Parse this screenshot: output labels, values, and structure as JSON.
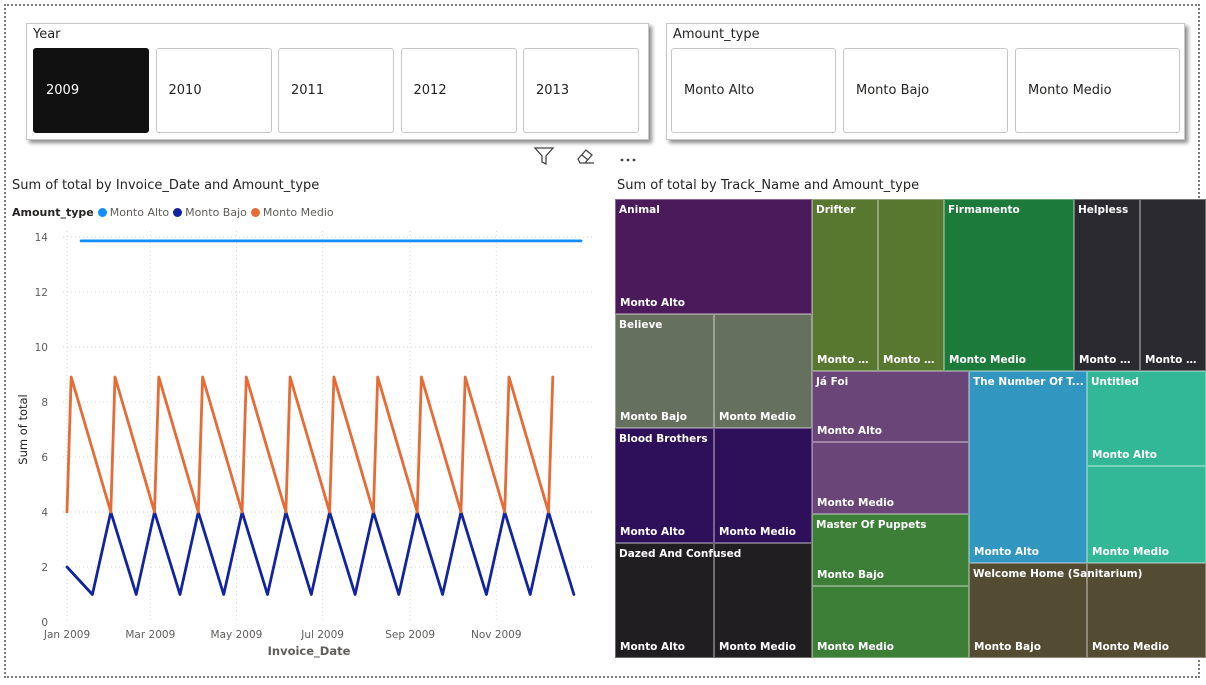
{
  "year_slicer": {
    "title": "Year",
    "options": [
      "2009",
      "2010",
      "2011",
      "2012",
      "2013"
    ],
    "selected": "2009"
  },
  "amount_slicer": {
    "title": "Amount_type",
    "options": [
      "Monto Alto",
      "Monto Bajo",
      "Monto Medio"
    ]
  },
  "header_icons": [
    "filter-icon",
    "eraser-icon",
    "more-options-icon"
  ],
  "line_chart": {
    "title": "Sum of total by Invoice_Date and Amount_type",
    "legend_title": "Amount_type",
    "chart_data": {
      "type": "line",
      "xlabel": "Invoice_Date",
      "ylabel": "Sum of total",
      "ylim": [
        0,
        14
      ],
      "yticks": [
        "0",
        "2",
        "4",
        "6",
        "8",
        "10",
        "12",
        "14"
      ],
      "xticks": [
        "Jan 2009",
        "Mar 2009",
        "May 2009",
        "Jul 2009",
        "Sep 2009",
        "Nov 2009"
      ],
      "grid": true,
      "legend_position": "top-left",
      "series": [
        {
          "name": "Monto Alto",
          "color": "#118dff",
          "points": [
            [
              "2009-01-11",
              13.86
            ],
            [
              "2009-12-31",
              13.86
            ]
          ]
        },
        {
          "name": "Monto Bajo",
          "color": "#12239e",
          "points": [
            [
              "2009-01-01",
              2
            ],
            [
              "2009-01-19",
              1
            ],
            [
              "2009-02-01",
              4
            ],
            [
              "2009-02-19",
              1
            ],
            [
              "2009-03-04",
              4
            ],
            [
              "2009-03-22",
              1
            ],
            [
              "2009-04-04",
              4
            ],
            [
              "2009-04-22",
              1
            ],
            [
              "2009-05-05",
              4
            ],
            [
              "2009-05-23",
              1
            ],
            [
              "2009-06-05",
              4
            ],
            [
              "2009-06-23",
              1
            ],
            [
              "2009-07-06",
              4
            ],
            [
              "2009-07-24",
              1
            ],
            [
              "2009-08-06",
              4
            ],
            [
              "2009-08-24",
              1
            ],
            [
              "2009-09-06",
              4
            ],
            [
              "2009-09-24",
              1
            ],
            [
              "2009-10-07",
              4
            ],
            [
              "2009-10-25",
              1
            ],
            [
              "2009-11-07",
              4
            ],
            [
              "2009-11-25",
              1
            ],
            [
              "2009-12-08",
              4
            ],
            [
              "2009-12-26",
              1
            ]
          ]
        },
        {
          "name": "Monto Medio",
          "color": "#e66c37",
          "points": [
            [
              "2009-01-01",
              4
            ],
            [
              "2009-01-04",
              8.91
            ],
            [
              "2009-02-01",
              4
            ],
            [
              "2009-02-04",
              8.91
            ],
            [
              "2009-03-04",
              4
            ],
            [
              "2009-03-07",
              8.91
            ],
            [
              "2009-04-04",
              4
            ],
            [
              "2009-04-07",
              8.91
            ],
            [
              "2009-05-05",
              4
            ],
            [
              "2009-05-08",
              8.91
            ],
            [
              "2009-06-05",
              4
            ],
            [
              "2009-06-08",
              8.91
            ],
            [
              "2009-07-06",
              4
            ],
            [
              "2009-07-09",
              8.91
            ],
            [
              "2009-08-06",
              4
            ],
            [
              "2009-08-09",
              8.91
            ],
            [
              "2009-09-06",
              4
            ],
            [
              "2009-09-09",
              8.91
            ],
            [
              "2009-10-07",
              4
            ],
            [
              "2009-10-10",
              8.91
            ],
            [
              "2009-11-07",
              4
            ],
            [
              "2009-11-10",
              8.91
            ],
            [
              "2009-12-08",
              4
            ],
            [
              "2009-12-11",
              8.91
            ]
          ]
        }
      ]
    }
  },
  "treemap": {
    "title": "Sum of total by Track_Name and Amount_type",
    "chart_data": {
      "type": "treemap",
      "groups": [
        {
          "name": "Animal",
          "color": "#4a1a5b",
          "items": [
            {
              "label": "Monto Alto"
            }
          ]
        },
        {
          "name": "Believe",
          "color": "#66705e",
          "items": [
            {
              "label": "Monto Bajo"
            },
            {
              "label": "Monto Medio"
            }
          ]
        },
        {
          "name": "Blood Brothers",
          "color": "#2e0f59",
          "items": [
            {
              "label": "Monto Alto"
            },
            {
              "label": "Monto Medio"
            }
          ]
        },
        {
          "name": "Dazed And Confused",
          "color": "#211e22",
          "items": [
            {
              "label": "Monto Alto"
            },
            {
              "label": "Monto Medio"
            }
          ]
        },
        {
          "name": "Drifter",
          "color": "#58782f",
          "items": [
            {
              "label": "Monto Al..."
            },
            {
              "label": "Monto M..."
            }
          ]
        },
        {
          "name": "Firmamento",
          "color": "#1c7a3a",
          "items": [
            {
              "label": "Monto Medio"
            }
          ]
        },
        {
          "name": "Helpless",
          "color": "#2c2a31",
          "items": [
            {
              "label": "Monto Al..."
            },
            {
              "label": "Monto B..."
            }
          ]
        },
        {
          "name": "Já Foi",
          "color": "#6a4577",
          "items": [
            {
              "label": "Monto Alto"
            },
            {
              "label": "Monto Medio"
            }
          ]
        },
        {
          "name": "Master Of Puppets",
          "color": "#3d7f36",
          "items": [
            {
              "label": "Monto Bajo"
            },
            {
              "label": "Monto Medio"
            }
          ]
        },
        {
          "name": "The Number Of T...",
          "color": "#3197c0",
          "items": [
            {
              "label": "Monto Alto"
            }
          ]
        },
        {
          "name": "Untitled",
          "color": "#33b897",
          "items": [
            {
              "label": "Monto Alto"
            },
            {
              "label": "Monto Medio"
            }
          ]
        },
        {
          "name": "Welcome Home (Sanitarium)",
          "color": "#534c33",
          "items": [
            {
              "label": "Monto Bajo"
            },
            {
              "label": "Monto Medio"
            }
          ]
        }
      ]
    }
  }
}
